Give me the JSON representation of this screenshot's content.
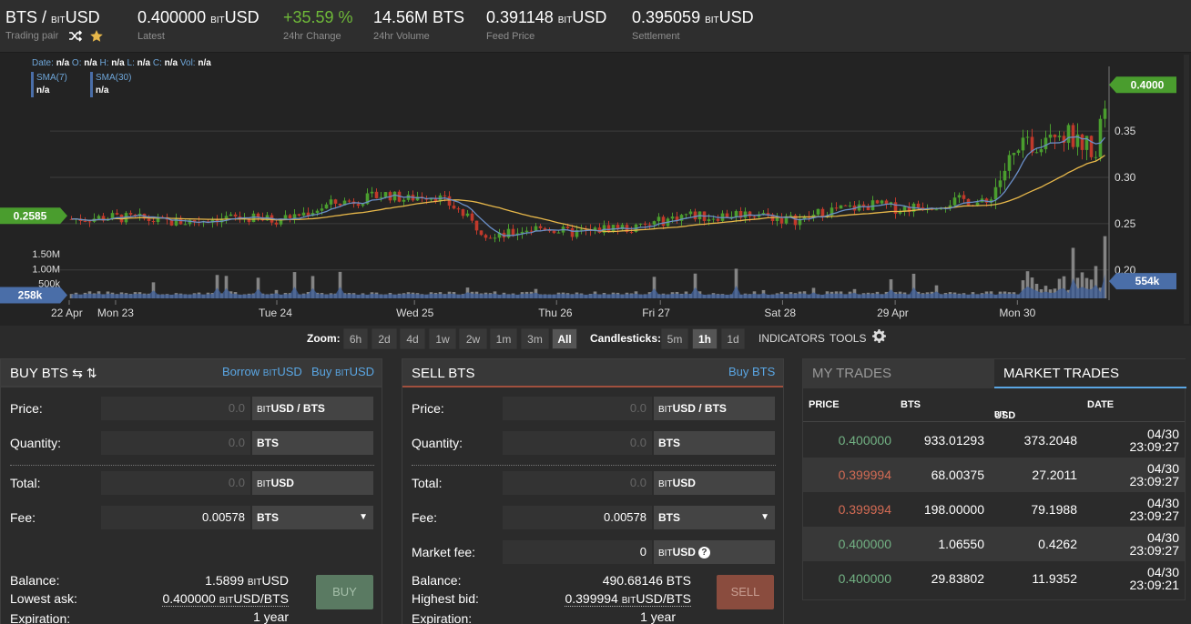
{
  "header": {
    "pair": {
      "base": "BTS",
      "sep": " / ",
      "quote_prefix": "BIT",
      "quote": "USD",
      "label": "Trading pair"
    },
    "stats": [
      {
        "value": "0.400000",
        "unit_prefix": "BIT",
        "unit": "USD",
        "label": "Latest",
        "color": "#ffffff"
      },
      {
        "value": "+35.59 %",
        "unit_prefix": "",
        "unit": "",
        "label": "24hr Change",
        "color": "#6fb939"
      },
      {
        "value": "14.56M BTS",
        "unit_prefix": "",
        "unit": "",
        "label": "24hr Volume",
        "color": "#ffffff"
      },
      {
        "value": "0.391148",
        "unit_prefix": "BIT",
        "unit": "USD",
        "label": "Feed Price",
        "color": "#ffffff"
      },
      {
        "value": "0.395059",
        "unit_prefix": "BIT",
        "unit": "USD",
        "label": "Settlement",
        "color": "#ffffff"
      }
    ]
  },
  "chart_legend": {
    "ohlc": [
      {
        "k": "Date:",
        "v": "n/a"
      },
      {
        "k": "O:",
        "v": "n/a"
      },
      {
        "k": "H:",
        "v": "n/a"
      },
      {
        "k": "L:",
        "v": "n/a"
      },
      {
        "k": "C:",
        "v": "n/a"
      },
      {
        "k": "Vol:",
        "v": "n/a"
      }
    ],
    "sma7_label": "SMA(7)",
    "sma7_value": "n/a",
    "sma30_label": "SMA(30)",
    "sma30_value": "n/a"
  },
  "chart_data": {
    "type": "candlestick",
    "y_axis_ticks": [
      "0.35",
      "0.30",
      "0.25",
      "0.20"
    ],
    "y_tick_values": [
      0.35,
      0.3,
      0.25,
      0.2
    ],
    "ylim": [
      0.189,
      0.415
    ],
    "volume_ticks": [
      "1.50M",
      "1.00M",
      "500k"
    ],
    "volume_tick_values": [
      1500000,
      1000000,
      500000
    ],
    "volume_max": 2150000,
    "x_axis_labels": [
      "22 Apr",
      "Mon 23",
      "Tue 24",
      "Wed 25",
      "Thu 26",
      "Fri 27",
      "Sat 28",
      "29 Apr",
      "Mon 30"
    ],
    "x_axis_positions": [
      0.0,
      0.063,
      0.282,
      0.469,
      0.662,
      0.803,
      0.969,
      1.122,
      1.288
    ],
    "markers": {
      "last_price": {
        "label": "0.4000",
        "value": 0.4,
        "color": "#4a9d2e"
      },
      "left_price": {
        "label": "0.2585",
        "value": 0.2585,
        "color": "#4a9d2e"
      },
      "left_volume": {
        "label": "258k",
        "value": 258000,
        "color": "#4a6ea8"
      },
      "right_volume": {
        "label": "554k",
        "value": 554000,
        "color": "#4a6ea8"
      }
    },
    "anchors": [
      [
        0,
        0.255
      ],
      [
        0.03,
        0.256
      ],
      [
        0.06,
        0.257
      ],
      [
        0.1,
        0.255
      ],
      [
        0.13,
        0.252
      ],
      [
        0.16,
        0.252
      ],
      [
        0.2,
        0.256
      ],
      [
        0.24,
        0.256
      ],
      [
        0.28,
        0.254
      ],
      [
        0.32,
        0.261
      ],
      [
        0.36,
        0.272
      ],
      [
        0.4,
        0.276
      ],
      [
        0.43,
        0.282
      ],
      [
        0.46,
        0.276
      ],
      [
        0.48,
        0.281
      ],
      [
        0.5,
        0.28
      ],
      [
        0.53,
        0.265
      ],
      [
        0.55,
        0.25
      ],
      [
        0.58,
        0.234
      ],
      [
        0.62,
        0.244
      ],
      [
        0.65,
        0.246
      ],
      [
        0.68,
        0.24
      ],
      [
        0.71,
        0.241
      ],
      [
        0.74,
        0.247
      ],
      [
        0.77,
        0.244
      ],
      [
        0.8,
        0.251
      ],
      [
        0.84,
        0.26
      ],
      [
        0.87,
        0.257
      ],
      [
        0.91,
        0.261
      ],
      [
        0.94,
        0.261
      ],
      [
        0.97,
        0.255
      ],
      [
        1.0,
        0.254
      ],
      [
        1.03,
        0.264
      ],
      [
        1.07,
        0.267
      ],
      [
        1.1,
        0.271
      ],
      [
        1.13,
        0.266
      ],
      [
        1.16,
        0.269
      ],
      [
        1.19,
        0.272
      ],
      [
        1.22,
        0.276
      ],
      [
        1.25,
        0.271
      ],
      [
        1.28,
        0.315
      ],
      [
        1.3,
        0.33
      ],
      [
        1.32,
        0.338
      ],
      [
        1.34,
        0.358
      ],
      [
        1.36,
        0.345
      ],
      [
        1.38,
        0.338
      ],
      [
        1.4,
        0.331
      ],
      [
        1.415,
        0.4
      ]
    ],
    "x_domain": [
      0,
      1.415
    ],
    "series": [
      {
        "name": "SMA(7)",
        "color": "#6a8fc8"
      },
      {
        "name": "SMA(30)",
        "color": "#e8b84a"
      }
    ]
  },
  "toolbar": {
    "zoom_label": "Zoom:",
    "zoom": [
      "6h",
      "2d",
      "4d",
      "1w",
      "2w",
      "1m",
      "3m",
      "All"
    ],
    "zoom_active": "All",
    "candle_label": "Candlesticks:",
    "candles": [
      "5m",
      "1h",
      "1d"
    ],
    "candle_active": "1h",
    "indicators": "INDICATORS",
    "tools": "TOOLS"
  },
  "buy": {
    "title": "BUY BTS",
    "title_icons": "⇆ ⇅",
    "borrow_link": {
      "pre": "Borrow ",
      "prefix": "BIT",
      "unit": "USD"
    },
    "buy_link": {
      "pre": "Buy ",
      "prefix": "BIT",
      "unit": "USD"
    },
    "price_label": "Price:",
    "price_placeholder": "0.0",
    "price_unit": "USD / BTS",
    "qty_label": "Quantity:",
    "qty_placeholder": "0.0",
    "qty_unit": "BTS",
    "total_label": "Total:",
    "total_placeholder": "0.0",
    "total_unit": "USD",
    "fee_label": "Fee:",
    "fee_value": "0.00578",
    "fee_unit": "BTS",
    "balance_label": "Balance:",
    "balance_value": "1.5899",
    "balance_unit": "USD",
    "lowest_label": "Lowest ask:",
    "lowest_value": "0.400000",
    "lowest_unit": "USD/BTS",
    "exp_label": "Expiration:",
    "exp_value": "1 year",
    "button": "BUY",
    "unit_prefix": "BIT"
  },
  "sell": {
    "title": "SELL BTS",
    "buy_link": "Buy BTS",
    "price_label": "Price:",
    "price_placeholder": "0.0",
    "price_unit": "USD / BTS",
    "qty_label": "Quantity:",
    "qty_placeholder": "0.0",
    "qty_unit": "BTS",
    "total_label": "Total:",
    "total_placeholder": "0.0",
    "total_unit": "USD",
    "fee_label": "Fee:",
    "fee_value": "0.00578",
    "fee_unit": "BTS",
    "mfee_label": "Market fee:",
    "mfee_value": "0",
    "mfee_unit": "USD",
    "balance_label": "Balance:",
    "balance_value": "490.68146 BTS",
    "highest_label": "Highest bid:",
    "highest_value": "0.399994",
    "highest_unit": "USD/BTS",
    "exp_label": "Expiration:",
    "exp_value": "1 year",
    "button": "SELL",
    "unit_prefix": "BIT"
  },
  "trades": {
    "tab_mine": "MY TRADES",
    "tab_market": "MARKET TRADES",
    "cols": [
      "PRICE",
      "BTS",
      "USD",
      "DATE"
    ],
    "col_prefix": "BIT",
    "rows": [
      {
        "p_main": "0.400000",
        "p_tail": "",
        "side": "buy",
        "bts": "933.01293",
        "usd": "373.2048",
        "d1": "04/30",
        "d2": "23:09:27"
      },
      {
        "p_main": "0.3",
        "p_tail": "99994",
        "side": "sell",
        "bts": "68.00375",
        "usd": "27.2011",
        "d1": "04/30",
        "d2": "23:09:27"
      },
      {
        "p_main": "0.3",
        "p_tail": "99994",
        "side": "sell",
        "bts": "198.00000",
        "usd": "79.1988",
        "d1": "04/30",
        "d2": "23:09:27"
      },
      {
        "p_main": "0.400000",
        "p_tail": "",
        "side": "buy",
        "bts": "1.06550",
        "usd": "0.4262",
        "d1": "04/30",
        "d2": "23:09:27"
      },
      {
        "p_main": "0.400000",
        "p_tail": "",
        "side": "buy",
        "bts": "29.83802",
        "usd": "11.9352",
        "d1": "04/30",
        "d2": "23:09:21"
      }
    ]
  }
}
